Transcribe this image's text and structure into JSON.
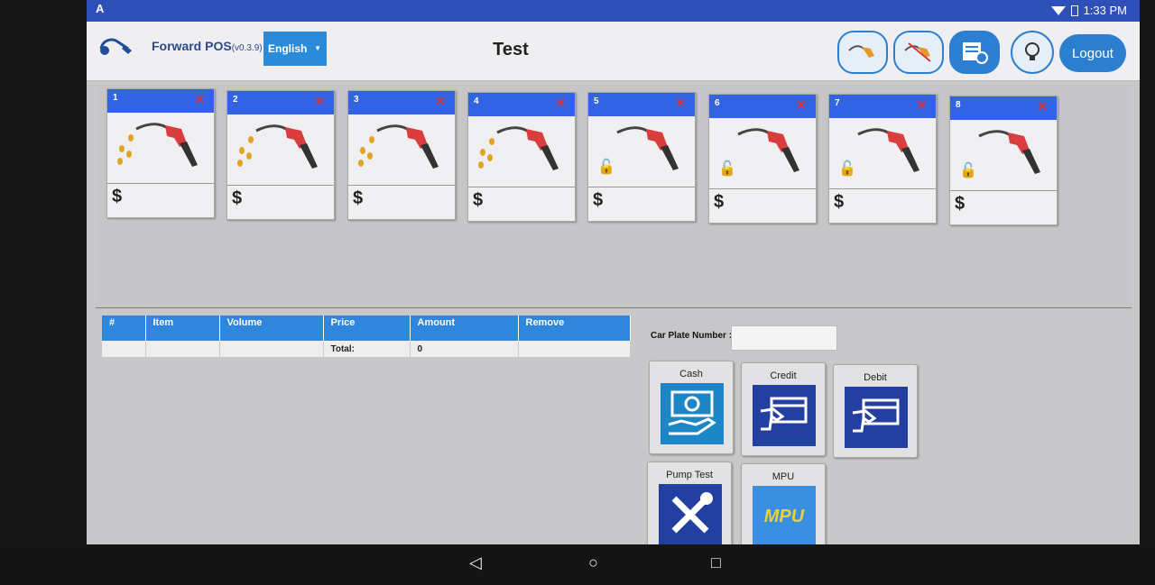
{
  "statusbar": {
    "notification_letter": "A",
    "time": "1:33 PM"
  },
  "header": {
    "brand": "Forward POS",
    "version": "(v0.3.9)",
    "language": "English",
    "title": "Test",
    "logout_label": "Logout",
    "icons": [
      "nozzle-icon",
      "nozzle-off-icon",
      "receipt-cash-icon",
      "lightbulb-icon"
    ]
  },
  "pumps": [
    {
      "number": "1",
      "state": "dispensing",
      "amount": "$"
    },
    {
      "number": "2",
      "state": "dispensing",
      "amount": "$"
    },
    {
      "number": "3",
      "state": "dispensing",
      "amount": "$"
    },
    {
      "number": "4",
      "state": "dispensing",
      "amount": "$"
    },
    {
      "number": "5",
      "state": "locked",
      "amount": "$"
    },
    {
      "number": "6",
      "state": "locked",
      "amount": "$"
    },
    {
      "number": "7",
      "state": "locked",
      "amount": "$"
    },
    {
      "number": "8",
      "state": "locked",
      "amount": "$"
    }
  ],
  "order": {
    "columns": [
      "#",
      "Item",
      "Volume",
      "Price",
      "Amount",
      "Remove"
    ],
    "total_label": "Total:",
    "total_value": "0"
  },
  "car_plate": {
    "label": "Car Plate Number :",
    "value": ""
  },
  "payments": {
    "cash": "Cash",
    "credit": "Credit",
    "debit": "Debit",
    "pump_test": "Pump Test",
    "mpu": "MPU"
  },
  "colors": {
    "statusbar": "#2f4fb9",
    "accent": "#2c7fcf",
    "pump_header": "#3163e4",
    "nozzle": "#d93d3d"
  }
}
